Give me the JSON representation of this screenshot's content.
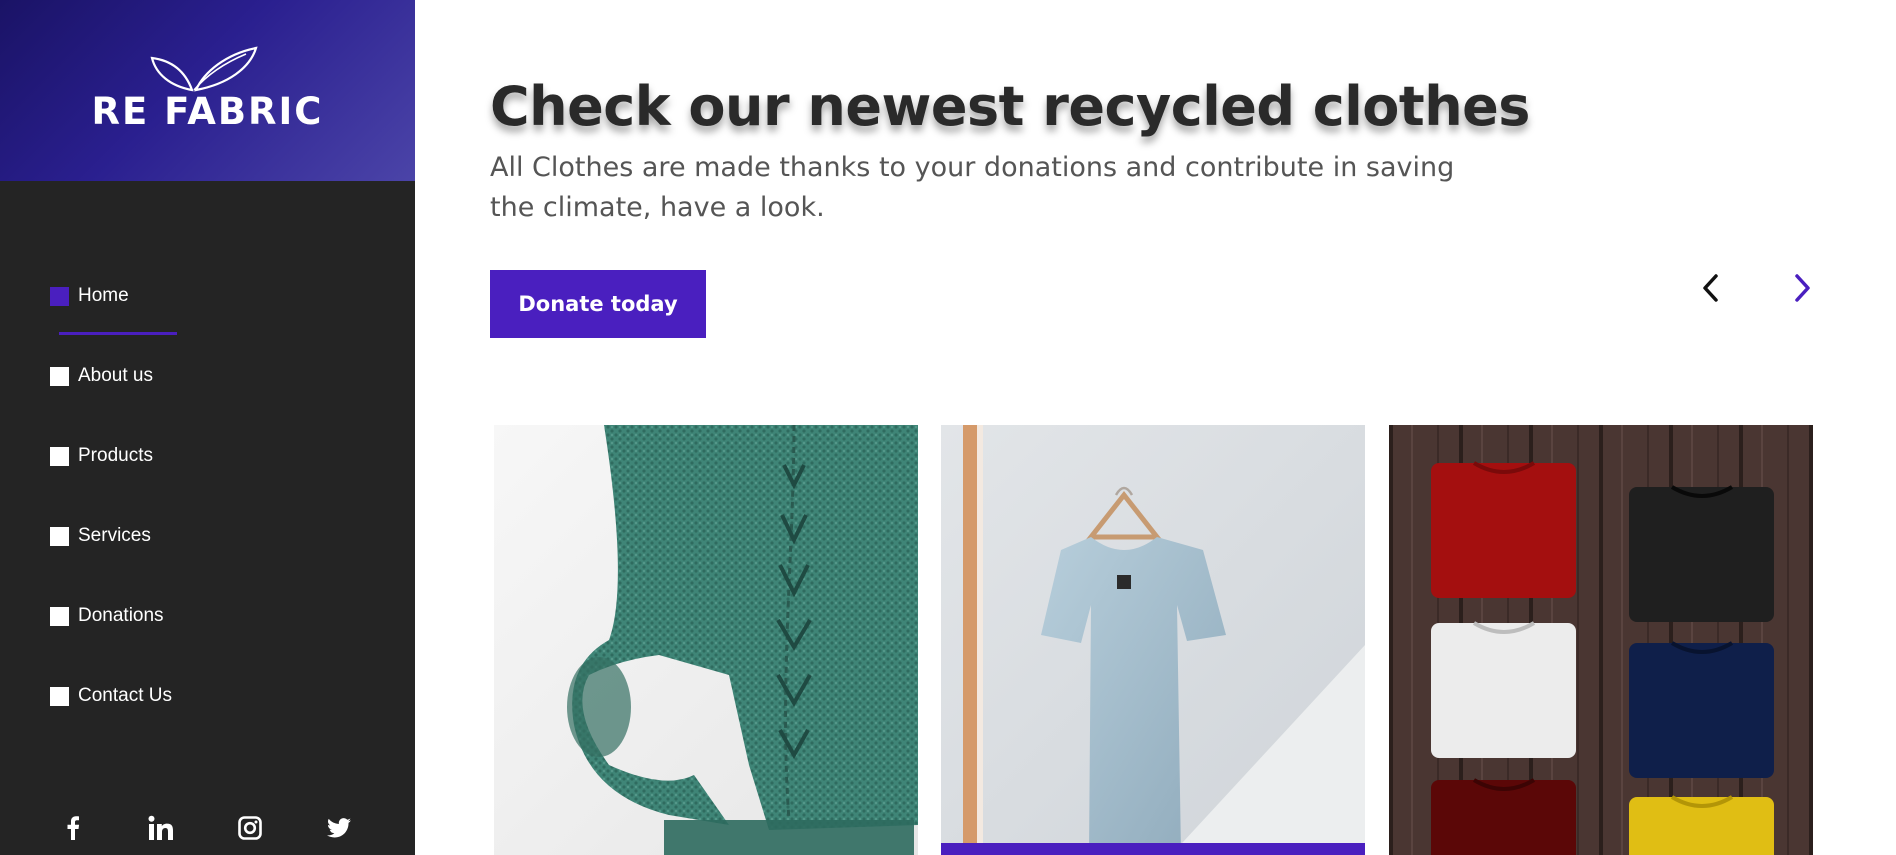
{
  "brand": {
    "name": "RE FABRIC"
  },
  "nav": {
    "items": [
      {
        "label": "Home",
        "active": true
      },
      {
        "label": "About us",
        "active": false
      },
      {
        "label": "Products",
        "active": false
      },
      {
        "label": "Services",
        "active": false
      },
      {
        "label": "Donations",
        "active": false
      },
      {
        "label": "Contact Us",
        "active": false
      }
    ]
  },
  "social": {
    "icons": [
      "facebook-icon",
      "linkedin-icon",
      "instagram-icon",
      "twitter-icon"
    ]
  },
  "hero": {
    "title": "Check our newest recycled clothes",
    "subtitle": "All Clothes are made thanks to your donations and contribute in saving the climate, have a look.",
    "donate_label": "Donate today"
  },
  "carousel": {
    "prev_icon": "chevron-left-icon",
    "next_icon": "chevron-right-icon",
    "cards": [
      {
        "image": "green-knit-sweater-photo"
      },
      {
        "image": "blue-tshirt-on-hanger-photo",
        "highlighted": true
      },
      {
        "image": "folded-colored-tshirts-photo"
      }
    ]
  },
  "colors": {
    "accent": "#4a1fbf",
    "sidebar_bg": "#242424",
    "brand_gradient_start": "#1a1366",
    "brand_gradient_end": "#4b44a8"
  }
}
